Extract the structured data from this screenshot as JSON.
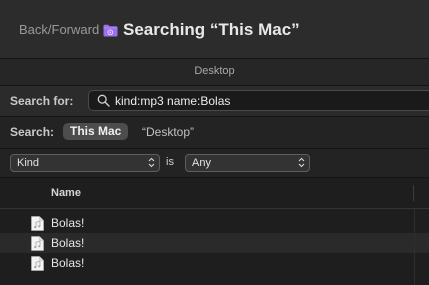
{
  "titlebar": {
    "nav_label": "Back/Forward",
    "folder_icon": "smart-folder-icon",
    "title": "Searching “This Mac”"
  },
  "scope_header": {
    "label": "Desktop"
  },
  "search": {
    "label": "Search for:",
    "icon": "search-icon",
    "query": "kind:mp3 name:Bolas"
  },
  "scope": {
    "label": "Search:",
    "selected": "This Mac",
    "other": "“Desktop”"
  },
  "criteria": {
    "attribute": "Kind",
    "operator": "is",
    "value": "Any"
  },
  "results": {
    "column_name": "Name",
    "items": [
      {
        "name": "Bolas!",
        "icon": "audio-file-icon"
      },
      {
        "name": "Bolas!",
        "icon": "audio-file-icon"
      },
      {
        "name": "Bolas!",
        "icon": "audio-file-icon"
      }
    ]
  },
  "colors": {
    "window_bg": "#1e1e1e",
    "titlebar_bg": "#2c2c2c",
    "folder_purple": "#9d6ff0",
    "selected_scope_bg": "#4d4d4d"
  }
}
